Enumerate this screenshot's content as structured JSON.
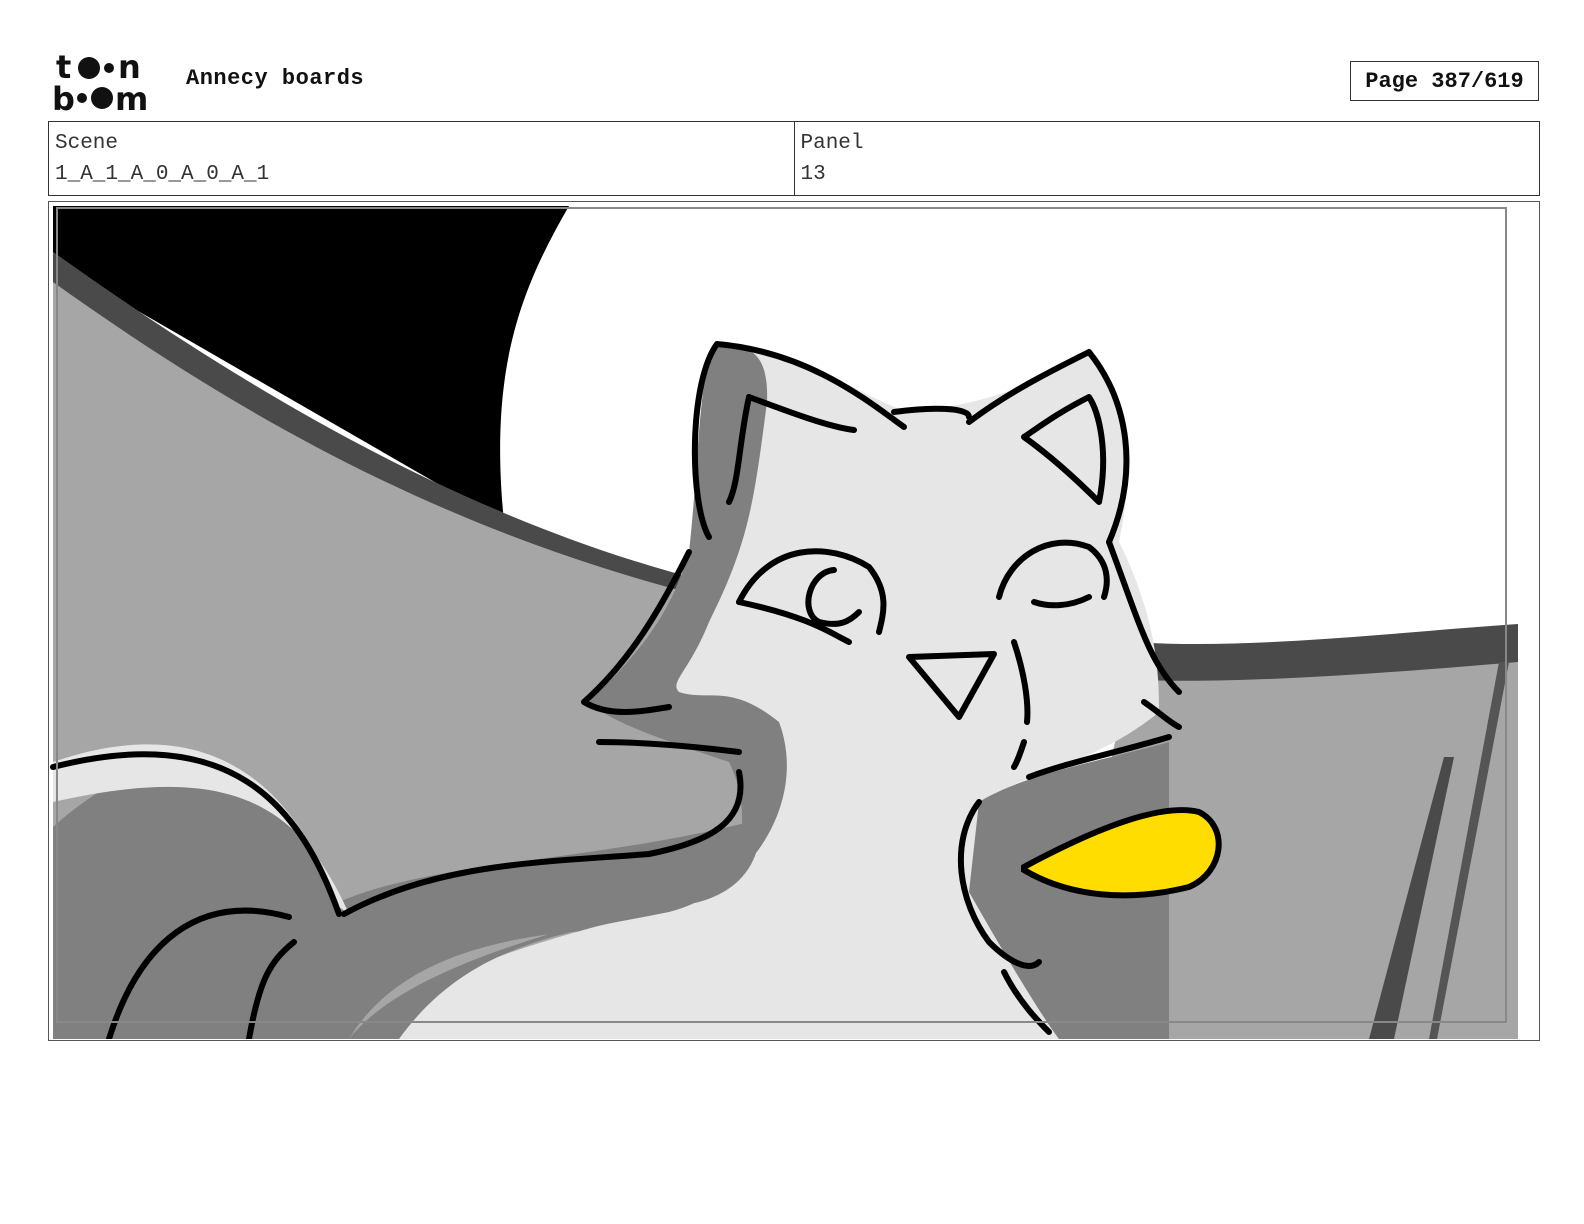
{
  "header": {
    "logo_text": "toon boom",
    "title": "Annecy boards",
    "page_label": "Page 387/619"
  },
  "info": {
    "scene_label": "Scene",
    "scene_value": "1_A_1_A_0_A_0_A_1",
    "panel_label": "Panel",
    "panel_value": "13"
  },
  "panel_image": {
    "subject": "cat-drawing",
    "colors": {
      "black": "#000000",
      "dark_gray": "#4a4a4a",
      "mid_gray": "#a6a6a6",
      "fur_gray": "#808080",
      "light_gray": "#e6e6e6",
      "yellow": "#ffdd00"
    }
  }
}
